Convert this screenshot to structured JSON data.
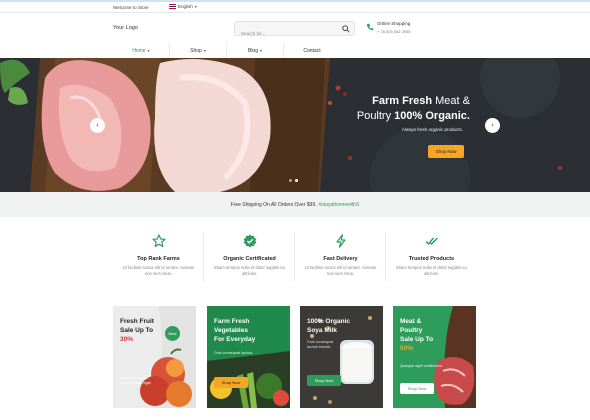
{
  "topbar": {
    "welcome": "Welcome to Store",
    "language": "English"
  },
  "header": {
    "logo": "Your Logo",
    "search_placeholder": "Search for...",
    "shipping_title": "Online Shopping",
    "shipping_phone": "+ 78 525 542 2505"
  },
  "nav": {
    "items": [
      {
        "label": "Home"
      },
      {
        "label": "Shop"
      },
      {
        "label": "Blog"
      },
      {
        "label": "Contact"
      }
    ]
  },
  "hero": {
    "title_light_1": "Farm Fresh",
    "title_bold_1": "Meat &",
    "title_light_2": "Poultry",
    "title_bold_2": "100% Organic.",
    "subtitle": "Always fresh organic products.",
    "cta": "Shop Now",
    "slides": 2,
    "active_slide": 2
  },
  "strip": {
    "text": "Free Shipping On All Orders Over $99.",
    "tag": "#stayathomewithS"
  },
  "features": [
    {
      "icon": "star-icon",
      "title": "Top Rank Farms",
      "desc": "Ut facilisis luctus elit id ornare. Aenean non sem risus."
    },
    {
      "icon": "badge-check-icon",
      "title": "Organic Certificated",
      "desc": "Etiam tempus nulla et dolor sagittis eu ultricies."
    },
    {
      "icon": "lightning-icon",
      "title": "Fast Delivery",
      "desc": "Ut facilisis luctus elit id ornare. Aenean non sem risus."
    },
    {
      "icon": "double-check-icon",
      "title": "Trusted Products",
      "desc": "Etiam tempus nulla et dolor sagittis eu ultricies."
    }
  ],
  "cards": [
    {
      "title_1": "Fresh Fruit",
      "title_2": "Sale Up To",
      "highlight": "30%",
      "badge": "New",
      "desc": "Aenean rhoncus blandit luctus eget."
    },
    {
      "title_1": "Farm Fresh",
      "title_2": "Vegetables",
      "title_3": "For Everyday",
      "desc": "Duis consequat lacinia.",
      "cta": "Shop Now"
    },
    {
      "title_1": "100% Organic",
      "title_2": "Soya Milk",
      "desc": "Duis consequat lacinia blandit.",
      "cta": "Shop Now"
    },
    {
      "title_1": "Meat &",
      "title_2": "Poultry",
      "title_3": "Sale Up To",
      "highlight": "50%",
      "desc": "Quisque eget vestibulum.",
      "cta": "Shop Now"
    }
  ],
  "colors": {
    "brand_green": "#2e9c5b",
    "accent_orange": "#f6a623",
    "sale_red": "#d9333f"
  }
}
